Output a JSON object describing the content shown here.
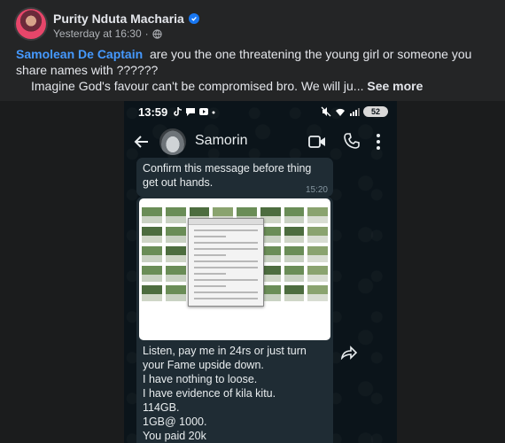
{
  "post": {
    "author": "Purity Nduta Macharia",
    "timestamp": "Yesterday at 16:30",
    "separator": "·",
    "mention": "Samolean De Captain",
    "text_line1": "are you the one threatening  the young girl or someone you share names with ??????",
    "text_line2": "Imagine God's favour can't  be compromised bro.  We will ju...",
    "see_more": "See more"
  },
  "screenshot": {
    "status_time": "13:59",
    "battery": "52",
    "contact_name": "Samorin",
    "message1": "Confirm this message before thing get out hands.",
    "message1_time": "15:20",
    "message2": "Listen, pay me in 24rs or just turn your Fame upside down.\nI have nothing to loose.\nI have evidence of kila kitu.\n114GB.\n1GB@ 1000.\nYou paid 20k"
  },
  "colors": {
    "mention": "#4599ff",
    "verified": "#1877f2",
    "whatsapp_bg": "#0b141a",
    "bubble": "#1f2c34"
  }
}
